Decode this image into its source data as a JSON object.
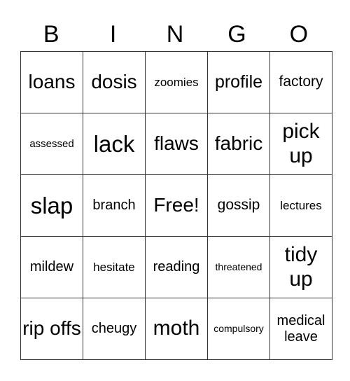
{
  "header": [
    "B",
    "I",
    "N",
    "G",
    "O"
  ],
  "grid": [
    [
      "loans",
      "dosis",
      "zoomies",
      "profile",
      "factory"
    ],
    [
      "assessed",
      "lack",
      "flaws",
      "fabric",
      "pick up"
    ],
    [
      "slap",
      "branch",
      "Free!",
      "gossip",
      "lectures"
    ],
    [
      "mildew",
      "hesitate",
      "reading",
      "threatened",
      "tidy up"
    ],
    [
      "rip offs",
      "cheugy",
      "moth",
      "compulsory",
      "medical leave"
    ]
  ]
}
